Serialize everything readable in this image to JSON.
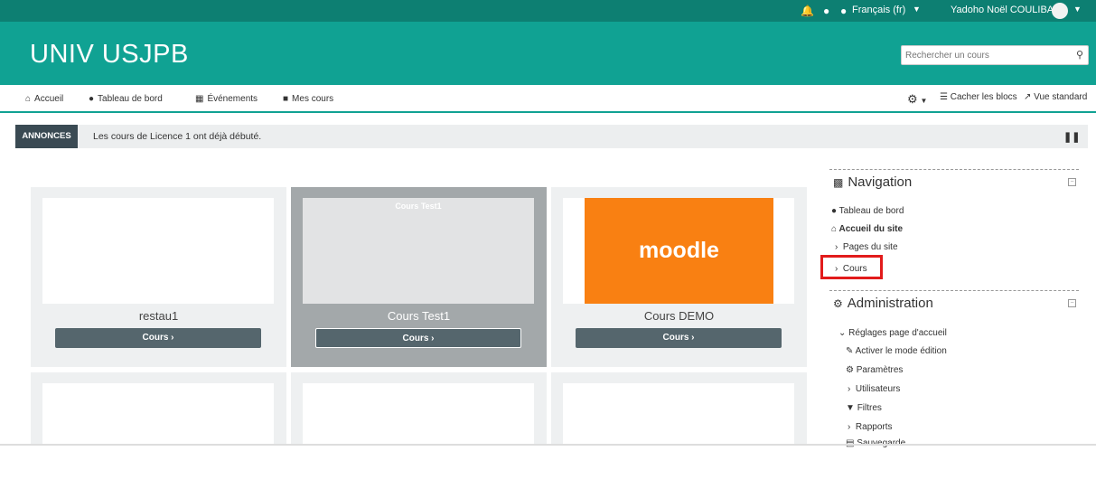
{
  "topbar": {
    "notification_icon": "bell-icon",
    "message_icon": "chat-icon",
    "language": "Français (fr)",
    "user_name": "Yadoho Noël COULIBALY"
  },
  "header": {
    "site_name": "UNIV USJPB",
    "search_placeholder": "Rechercher un cours"
  },
  "nav": {
    "items": [
      {
        "label": "Accueil",
        "icon": "home-icon"
      },
      {
        "label": "Tableau de bord",
        "icon": "dashboard-icon"
      },
      {
        "label": "Événements",
        "icon": "calendar-icon"
      },
      {
        "label": "Mes cours",
        "icon": "briefcase-icon"
      }
    ],
    "hide_blocks": "Cacher les blocs",
    "standard_view": "Vue standard"
  },
  "announcement": {
    "label": "ANNONCES",
    "text": "Les cours de Licence 1 ont déjà débuté."
  },
  "courses": [
    {
      "name": "restau1",
      "button": "Cours ›",
      "thumb_title": ""
    },
    {
      "name": "Cours Test1",
      "button": "Cours ›",
      "thumb_title": "Cours Test1"
    },
    {
      "name": "Cours DEMO",
      "button": "Cours ›",
      "thumb_title": "",
      "logo_text": "moodle"
    }
  ],
  "navigation_block": {
    "title": "Navigation",
    "items": [
      "Tableau de bord",
      "Accueil du site",
      "Pages du site",
      "Cours"
    ]
  },
  "administration_block": {
    "title": "Administration",
    "items": [
      "Réglages page d'accueil",
      "Activer le mode édition",
      "Paramètres",
      "Utilisateurs",
      "Filtres",
      "Rapports",
      "Sauvegarde"
    ]
  },
  "colors": {
    "topbar": "#0d7f72",
    "header": "#10a293",
    "highlight": "#e21b1b",
    "moodle_orange": "#f98012"
  }
}
